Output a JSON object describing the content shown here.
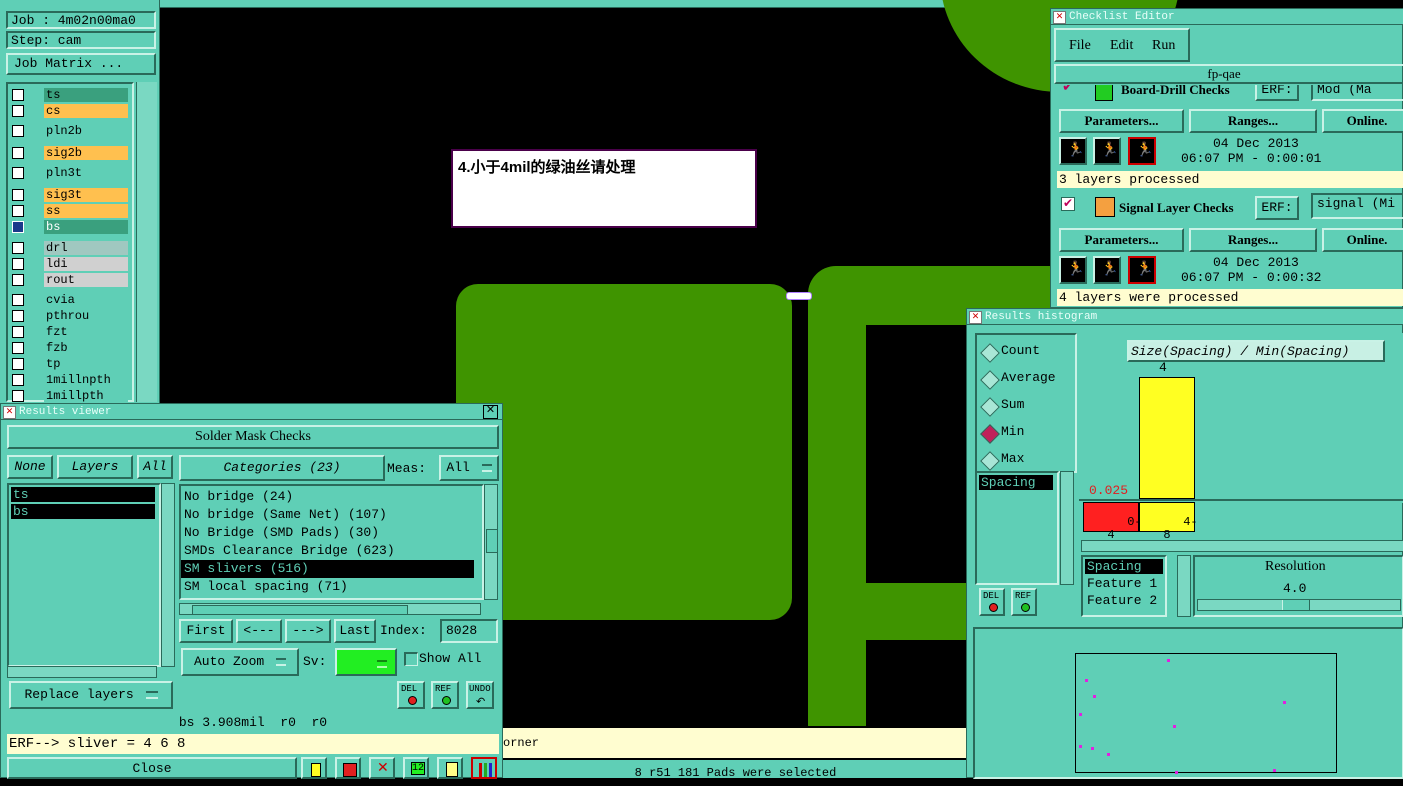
{
  "job_panel": {
    "job": "Job : 4m02n00ma0",
    "step": "Step: cam",
    "job_matrix": "Job Matrix ...",
    "layers": [
      {
        "name": "ts",
        "color": "#3aa07e",
        "checked": false
      },
      {
        "name": "cs",
        "color": "#ffc04f",
        "checked": false
      },
      {
        "name": "pln2b",
        "color": "#5fcfb6",
        "checked": false
      },
      {
        "name": "sig2b",
        "color": "#ffc04f",
        "checked": false
      },
      {
        "name": "pln3t",
        "color": "#5fcfb6",
        "checked": false
      },
      {
        "name": "sig3t",
        "color": "#ffc04f",
        "checked": false
      },
      {
        "name": "ss",
        "color": "#ffc04f",
        "checked": false
      },
      {
        "name": "bs",
        "color": "#3aa07e",
        "checked": true
      },
      {
        "name": "drl",
        "color": "#a0c8c0",
        "checked": false
      },
      {
        "name": "ldi",
        "color": "#d0d0d0",
        "checked": false
      },
      {
        "name": "rout",
        "color": "#d0d0d0",
        "checked": false
      },
      {
        "name": "cvia",
        "color": "#5fcfb6",
        "checked": false
      },
      {
        "name": "pthrou",
        "color": "#5fcfb6",
        "checked": false
      },
      {
        "name": "fzt",
        "color": "#5fcfb6",
        "checked": false
      },
      {
        "name": "fzb",
        "color": "#5fcfb6",
        "checked": false
      },
      {
        "name": "tp",
        "color": "#5fcfb6",
        "checked": false
      },
      {
        "name": "1millnpth",
        "color": "#5fcfb6",
        "checked": false
      },
      {
        "name": "1millpth",
        "color": "#5fcfb6",
        "checked": false
      }
    ]
  },
  "annotation": {
    "text": "4.小于4mil的绿油丝请处理"
  },
  "results_viewer": {
    "title": "Results viewer",
    "header": "Solder Mask Checks",
    "none_label": "None",
    "layers_label": "Layers",
    "all_label": "All",
    "layer_items": [
      "ts",
      "bs"
    ],
    "categories_label": "Categories (23)",
    "meas_label": "Meas:",
    "meas_value": "All",
    "categories": [
      {
        "label": "No bridge (24)",
        "selected": false
      },
      {
        "label": "No bridge (Same Net) (107)",
        "selected": false
      },
      {
        "label": "No Bridge (SMD Pads) (30)",
        "selected": false
      },
      {
        "label": "SMDs Clearance Bridge (623)",
        "selected": false
      },
      {
        "label": "SM slivers (516)",
        "selected": true
      },
      {
        "label": "SM local spacing (71)",
        "selected": false
      }
    ],
    "first": "First",
    "prev": "<---",
    "next": "--->",
    "last": "Last",
    "index_label": "Index:",
    "index_value": "8028",
    "auto_zoom": "Auto Zoom",
    "sv_label": "Sv:",
    "show_all": "Show All",
    "replace_layers": "Replace layers",
    "del": "DEL",
    "ref": "REF",
    "undo": "UNDO",
    "status_line": "bs 3.908mil  r0  r0",
    "erf_line": "ERF--> sliver = 4 6 8",
    "close": "Close"
  },
  "bottom_status": {
    "corner_text": "orner",
    "selected_text": "8 r51 181 Pads were selected"
  },
  "checklist_editor": {
    "title": "Checklist Editor",
    "menu": [
      "File",
      "Edit",
      "Run"
    ],
    "checklist_name": "fp-qae",
    "checks": [
      {
        "name": "Board-Drill Checks",
        "erf_label": "ERF:",
        "erf_value": "Mod (Ma",
        "buttons": [
          "Parameters...",
          "Ranges...",
          "Online."
        ],
        "date": "04 Dec 2013",
        "time": "06:07 PM - 0:00:01",
        "status": "3 layers processed"
      },
      {
        "name": "Signal Layer Checks",
        "erf_label": "ERF:",
        "erf_value": "signal (Mi",
        "buttons": [
          "Parameters...",
          "Ranges...",
          "Online."
        ],
        "date": "04 Dec 2013",
        "time": "06:07 PM - 0:00:32",
        "status": "4 layers were processed"
      }
    ]
  },
  "histogram": {
    "title": "Results histogram",
    "modes": [
      {
        "label": "Count",
        "selected": false
      },
      {
        "label": "Average",
        "selected": false
      },
      {
        "label": "Sum",
        "selected": false
      },
      {
        "label": "Min",
        "selected": true
      },
      {
        "label": "Max",
        "selected": false
      }
    ],
    "measure_list": [
      "Spacing"
    ],
    "chart_title": "Size(Spacing) / Min(Spacing)",
    "bar_value": "4",
    "bar_fraction": 1.0,
    "y_min_label": "0.025",
    "bins": [
      {
        "label": "0-\n4",
        "color": "#ff2020"
      },
      {
        "label": "4-\n8",
        "color": "#ffff22"
      }
    ],
    "sort_list": [
      "Spacing",
      "Feature 1",
      "Feature 2"
    ],
    "resolution_label": "Resolution",
    "resolution_value": "4.0",
    "del": "DEL",
    "ref": "REF"
  },
  "colors": {
    "panel": "#5fcfb6",
    "copper": "#3f9400",
    "highlight": "#ffff22",
    "erf_bg": "#fffdd0"
  }
}
